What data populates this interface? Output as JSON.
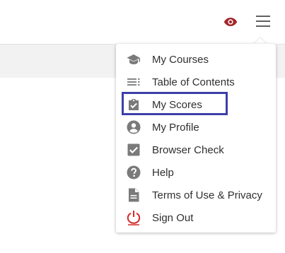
{
  "colors": {
    "accent_eye": "#a3282c",
    "icon_gray": "#7a7a7a",
    "signout_red": "#d62828",
    "highlight_border": "#3c3fa8"
  },
  "header": {
    "icons": [
      "eye-icon",
      "hamburger-menu-icon"
    ]
  },
  "menu": {
    "items": [
      {
        "label": "My Courses",
        "icon": "graduation-cap-icon"
      },
      {
        "label": "Table of Contents",
        "icon": "list-icon"
      },
      {
        "label": "My Scores",
        "icon": "clipboard-check-icon",
        "highlighted": true
      },
      {
        "label": "My Profile",
        "icon": "account-circle-icon"
      },
      {
        "label": "Browser Check",
        "icon": "checkbox-icon"
      },
      {
        "label": "Help",
        "icon": "help-circle-icon"
      },
      {
        "label": "Terms of Use & Privacy",
        "icon": "document-icon"
      },
      {
        "label": "Sign Out",
        "icon": "power-icon"
      }
    ]
  }
}
